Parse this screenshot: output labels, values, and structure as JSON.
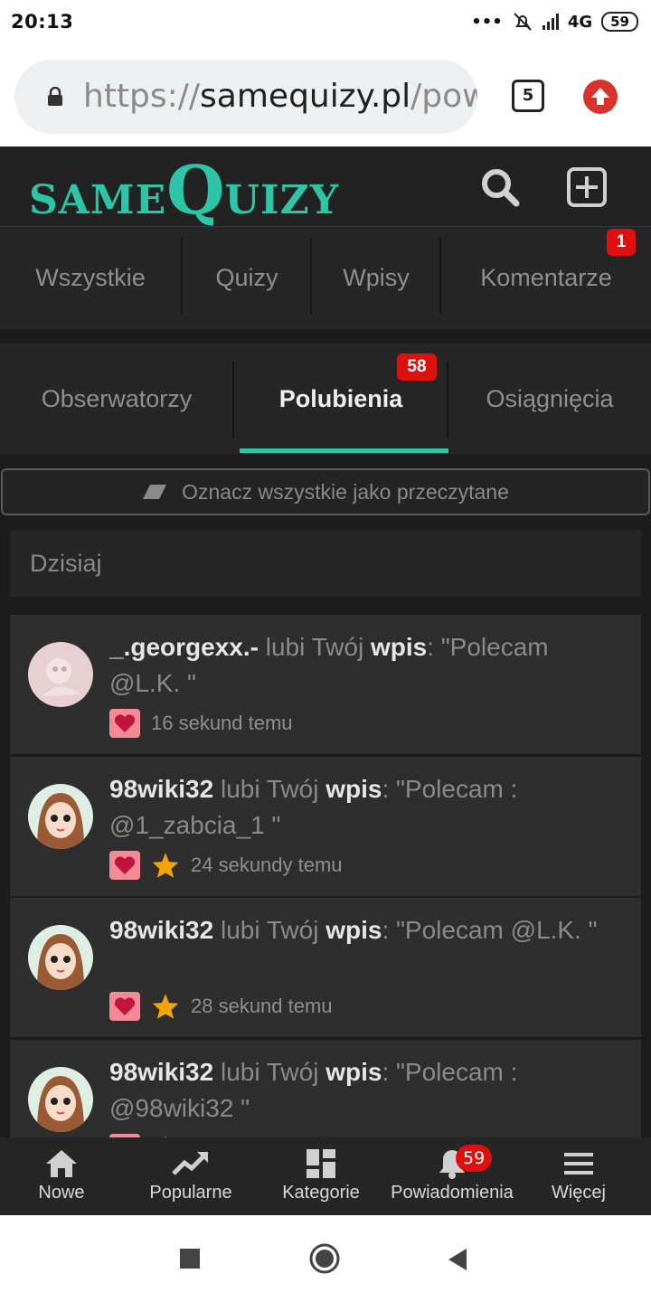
{
  "status_bar": {
    "time": "20:13",
    "network": "4G",
    "battery": "59"
  },
  "browser": {
    "url_scheme": "https://",
    "url_domain": "samequizy.pl",
    "url_path": "/pow",
    "tab_count": "5"
  },
  "site": {
    "logo_same": "SAME",
    "logo_q": "Q",
    "logo_uizy": "UIZY",
    "accent_color": "#2ec4a7"
  },
  "tabs_primary": [
    {
      "label": "Wszystkie"
    },
    {
      "label": "Quizy"
    },
    {
      "label": "Wpisy"
    },
    {
      "label": "Komentarze",
      "badge": "1"
    }
  ],
  "tabs_secondary": [
    {
      "label": "Obserwatorzy"
    },
    {
      "label": "Polubienia",
      "badge": "58",
      "active": true
    },
    {
      "label": "Osiągnięcia"
    }
  ],
  "mark_all_read": "Oznacz wszystkie jako przeczytane",
  "day_label": "Dzisiaj",
  "notifications": [
    {
      "user": "_.georgexx.-",
      "verb": " lubi Twój ",
      "object": "wpis",
      "quote": ": \"Polecam @L.K. \"",
      "time": "16 sekund temu",
      "star": false
    },
    {
      "user": "98wiki32",
      "verb": " lubi Twój ",
      "object": "wpis",
      "quote": ": \"Polecam : @1_zabcia_1 \"",
      "time": "24 sekundy temu",
      "star": true
    },
    {
      "user": "98wiki32",
      "verb": " lubi Twój ",
      "object": "wpis",
      "quote": ": \"Polecam @L.K. \"",
      "time": "28 sekund temu",
      "star": true
    },
    {
      "user": "98wiki32",
      "verb": " lubi Twój ",
      "object": "wpis",
      "quote": ": \"Polecam : @98wiki32 \"",
      "time": "",
      "star": true
    }
  ],
  "bottom_nav": [
    {
      "label": "Nowe",
      "icon": "home-icon"
    },
    {
      "label": "Popularne",
      "icon": "trending-icon"
    },
    {
      "label": "Kategorie",
      "icon": "grid-icon"
    },
    {
      "label": "Powiadomienia",
      "icon": "bell-icon",
      "badge": "59"
    },
    {
      "label": "Więcej",
      "icon": "menu-icon"
    }
  ]
}
